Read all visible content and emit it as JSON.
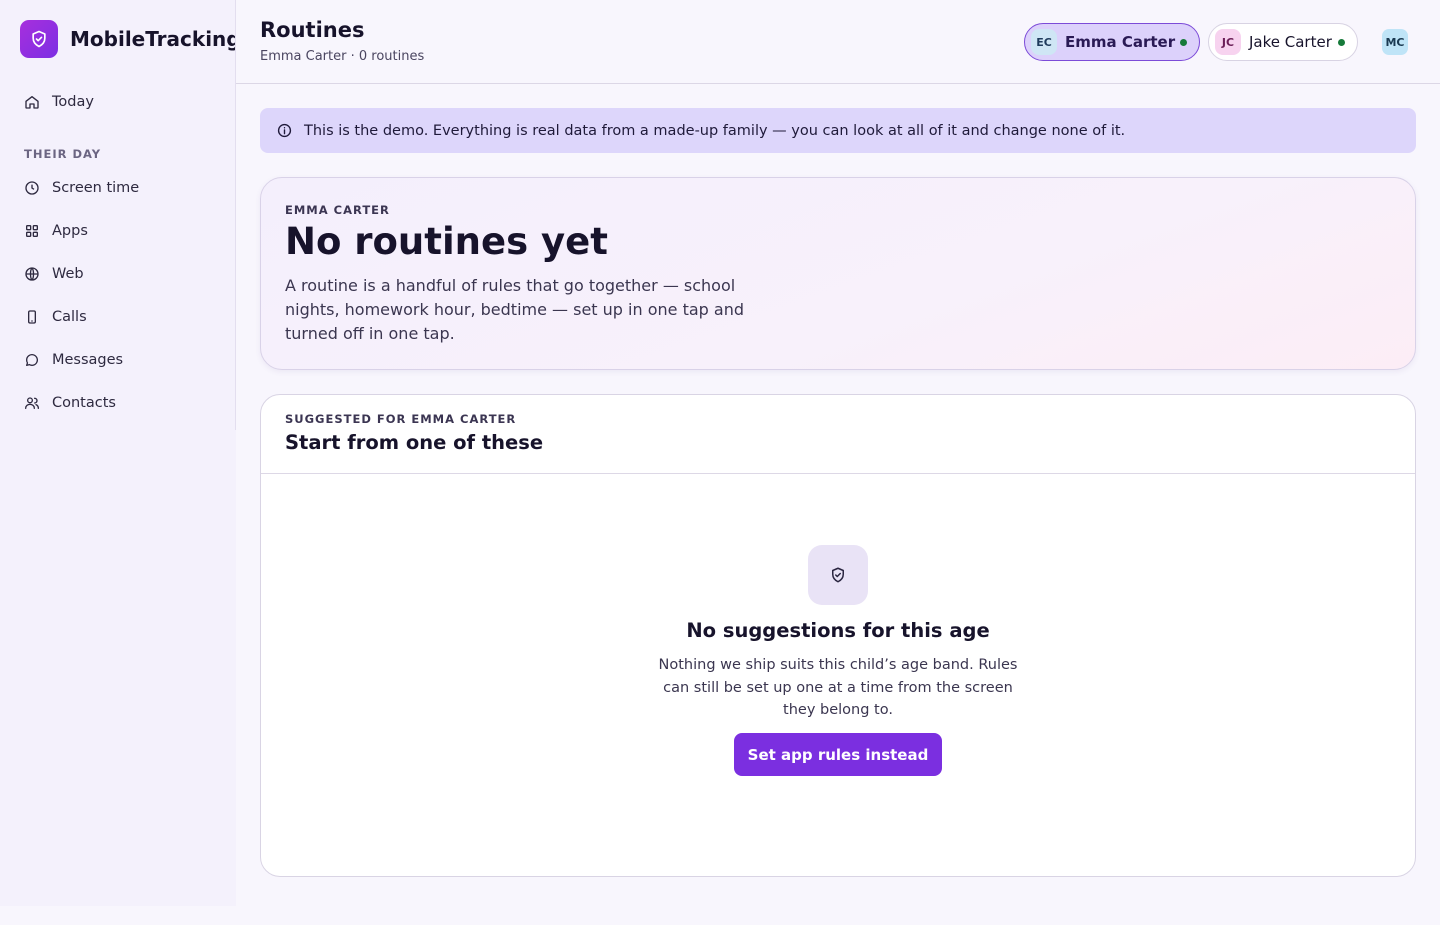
{
  "app": {
    "name": "MobileTracking",
    "logo_icon": "shield-check-icon",
    "brand_gradient": [
      "#a72fdd",
      "#7c2fe3"
    ]
  },
  "sidebar": {
    "top_item": {
      "label": "Today",
      "icon": "home-icon"
    },
    "section_label": "THEIR DAY",
    "items": [
      {
        "label": "Screen time",
        "icon": "clock-icon"
      },
      {
        "label": "Apps",
        "icon": "grid-icon"
      },
      {
        "label": "Web",
        "icon": "globe-icon"
      },
      {
        "label": "Calls",
        "icon": "phone-icon"
      },
      {
        "label": "Messages",
        "icon": "message-icon"
      },
      {
        "label": "Contacts",
        "icon": "users-icon"
      }
    ]
  },
  "header": {
    "title": "Routines",
    "subtitle": "Emma Carter · 0 routines",
    "children": [
      {
        "initials": "EC",
        "name": "Emma Carter",
        "selected": true,
        "online": true
      },
      {
        "initials": "JC",
        "name": "Jake Carter",
        "selected": false,
        "online": true
      }
    ],
    "user_initials": "MC"
  },
  "banner": {
    "icon": "info-icon",
    "text": "This is the demo. Everything is real data from a made-up family — you can look at all of it and change none of it."
  },
  "hero": {
    "eyebrow": "EMMA CARTER",
    "title": "No routines yet",
    "description": "A routine is a handful of rules that go together — school nights, homework hour, bedtime — set up in one tap and turned off in one tap."
  },
  "suggestions": {
    "eyebrow": "SUGGESTED FOR EMMA CARTER",
    "title": "Start from one of these",
    "empty": {
      "icon": "shield-check-icon",
      "title": "No suggestions for this age",
      "description": "Nothing we ship suits this child’s age band. Rules can still be set up one at a time from the screen they belong to.",
      "button_label": "Set app rules instead"
    }
  },
  "colors": {
    "accent": "#7b2fe0",
    "banner_bg": "#ddd6fb",
    "online_dot": "#167a3a"
  }
}
